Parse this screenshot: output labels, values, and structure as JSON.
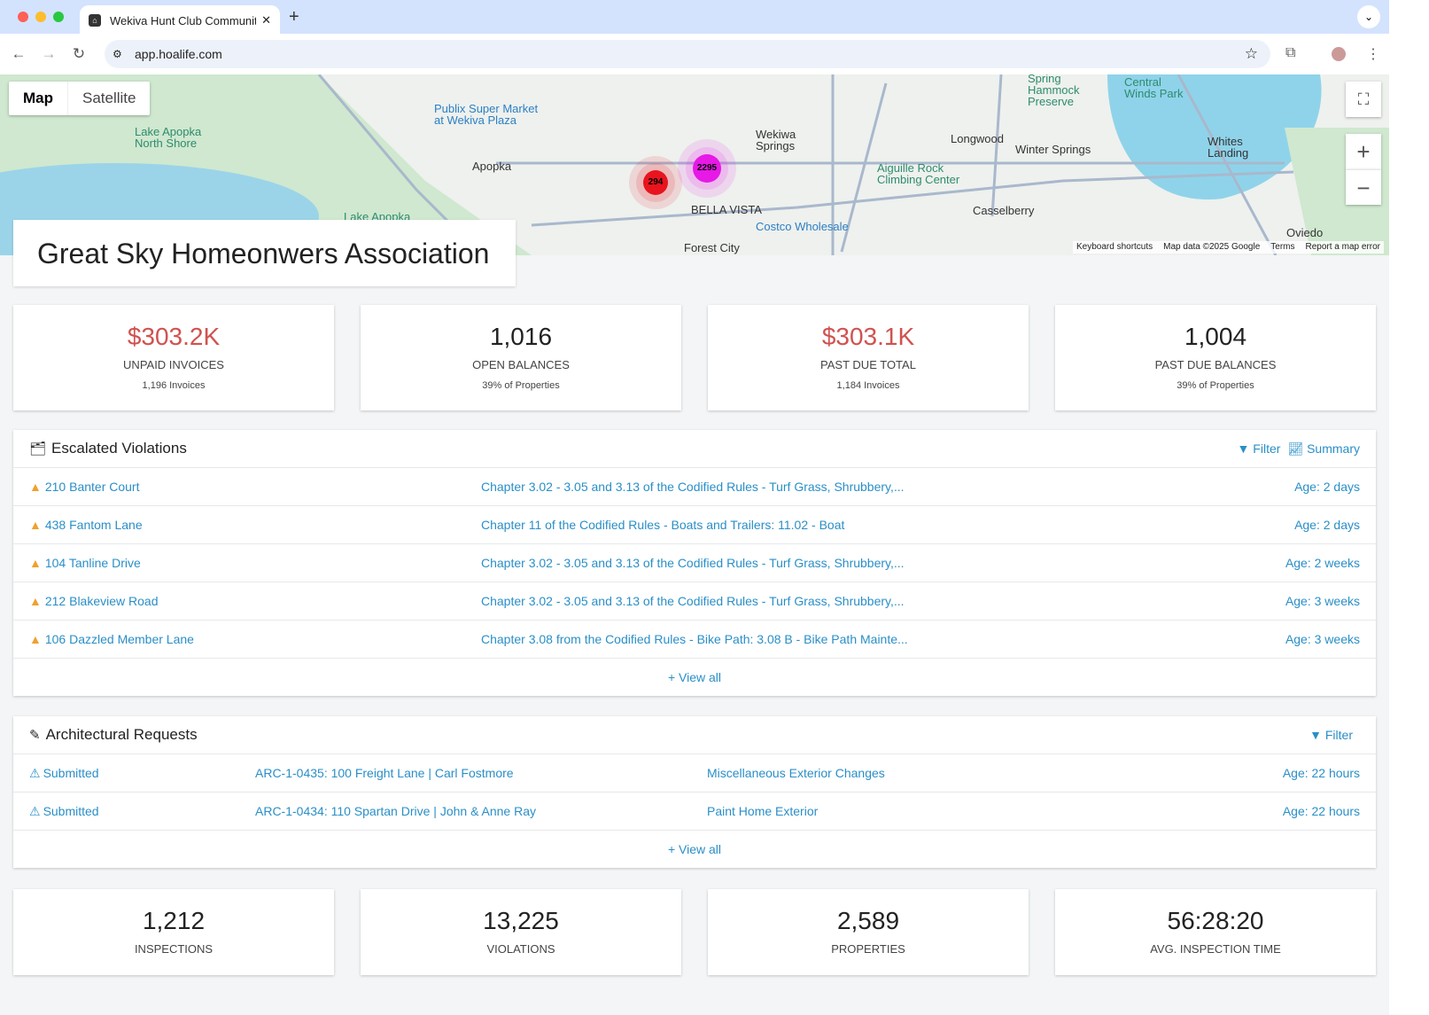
{
  "browser": {
    "tab_title": "Wekiva Hunt Club Community",
    "url": "app.hoalife.com"
  },
  "map": {
    "type_options": [
      "Map",
      "Satellite"
    ],
    "selected_type": "Map",
    "labels": [
      {
        "t": "Lake Apopka\nNorth Shore",
        "c": "g",
        "p": [
          152,
          142
        ]
      },
      {
        "t": "Publix Super Market\nat Wekiva Plaza",
        "c": "b",
        "p": [
          490,
          116
        ]
      },
      {
        "t": "Apopka",
        "c": "",
        "p": [
          533,
          181
        ]
      },
      {
        "t": "Wekiwa\nSprings",
        "c": "",
        "p": [
          853,
          145
        ]
      },
      {
        "t": "BELLA VISTA",
        "c": "",
        "p": [
          780,
          230
        ]
      },
      {
        "t": "Longwood",
        "c": "",
        "p": [
          1073,
          150
        ]
      },
      {
        "t": "Winter Springs",
        "c": "",
        "p": [
          1146,
          162
        ]
      },
      {
        "t": "Spring\nHammock\nPreserve",
        "c": "g",
        "p": [
          1160,
          82
        ]
      },
      {
        "t": "Central\nWinds Park",
        "c": "g",
        "p": [
          1269,
          86
        ]
      },
      {
        "t": "Whites\nLanding",
        "c": "",
        "p": [
          1363,
          153
        ]
      },
      {
        "t": "Aiguille Rock\nClimbing Center",
        "c": "g",
        "p": [
          990,
          183
        ]
      },
      {
        "t": "Casselberry",
        "c": "",
        "p": [
          1098,
          231
        ]
      },
      {
        "t": "Costco Wholesale",
        "c": "b",
        "p": [
          853,
          249
        ]
      },
      {
        "t": "Forest City",
        "c": "",
        "p": [
          772,
          273
        ]
      },
      {
        "t": "Oviedo",
        "c": "",
        "p": [
          1452,
          256
        ]
      },
      {
        "t": "Lake Apopka",
        "c": "g",
        "p": [
          388,
          238
        ]
      }
    ],
    "clusters": [
      {
        "count": "294",
        "color": "#e8141e"
      },
      {
        "count": "2295",
        "color": "#e619e6"
      }
    ],
    "attribution": [
      "Keyboard shortcuts",
      "Map data ©2025 Google",
      "Terms",
      "Report a map error"
    ]
  },
  "association_name": "Great Sky Homeonwers Association",
  "finance_stats": [
    {
      "value": "$303.2K",
      "label": "UNPAID INVOICES",
      "sub": "1,196 Invoices",
      "highlight": true
    },
    {
      "value": "1,016",
      "label": "OPEN BALANCES",
      "sub": "39% of Properties",
      "highlight": false
    },
    {
      "value": "$303.1K",
      "label": "PAST DUE TOTAL",
      "sub": "1,184 Invoices",
      "highlight": true
    },
    {
      "value": "1,004",
      "label": "PAST DUE BALANCES",
      "sub": "39% of Properties",
      "highlight": false
    }
  ],
  "violations": {
    "title": "Escalated Violations",
    "filter_label": "Filter",
    "summary_label": "Summary",
    "view_all": "+ View all",
    "rows": [
      {
        "address": "210 Banter Court",
        "rule": "Chapter 3.02 - 3.05 and 3.13 of the Codified Rules - Turf Grass, Shrubbery,...",
        "age": "Age: 2 days"
      },
      {
        "address": "438 Fantom Lane",
        "rule": "Chapter 11 of the Codified Rules - Boats and Trailers: 11.02 - Boat",
        "age": "Age: 2 days"
      },
      {
        "address": "104 Tanline Drive",
        "rule": "Chapter 3.02 - 3.05 and 3.13 of the Codified Rules - Turf Grass, Shrubbery,...",
        "age": "Age: 2 weeks"
      },
      {
        "address": "212 Blakeview Road",
        "rule": "Chapter 3.02 - 3.05 and 3.13 of the Codified Rules - Turf Grass, Shrubbery,...",
        "age": "Age: 3 weeks"
      },
      {
        "address": "106 Dazzled Member Lane",
        "rule": "Chapter 3.08 from the Codified Rules - Bike Path: 3.08 B - Bike Path Mainte...",
        "age": "Age: 3 weeks"
      }
    ]
  },
  "arch": {
    "title": "Architectural Requests",
    "filter_label": "Filter",
    "view_all": "+ View all",
    "rows": [
      {
        "status": "Submitted",
        "id": "ARC-1-0435: 100 Freight Lane",
        "owner": "| Carl Fostmore",
        "type": "Miscellaneous Exterior Changes",
        "age": "Age: 22 hours"
      },
      {
        "status": "Submitted",
        "id": "ARC-1-0434: 110 Spartan Drive",
        "owner": "| John & Anne Ray",
        "type": "Paint Home Exterior",
        "age": "Age: 22 hours"
      }
    ]
  },
  "ops_stats": [
    {
      "value": "1,212",
      "label": "INSPECTIONS"
    },
    {
      "value": "13,225",
      "label": "VIOLATIONS"
    },
    {
      "value": "2,589",
      "label": "PROPERTIES"
    },
    {
      "value": "56:28:20",
      "label": "AVG. INSPECTION TIME"
    }
  ],
  "colors": {
    "link": "#2a8fc7",
    "money": "#d0524f",
    "warning": "#f0a030"
  }
}
